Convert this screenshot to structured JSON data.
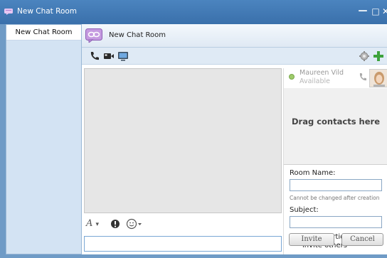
{
  "window": {
    "title": "New Chat Room",
    "minimize_glyph": "—",
    "maximize_glyph": "□",
    "close_glyph": "✕"
  },
  "tabs": [
    {
      "label": "New Chat Room",
      "selected": true
    }
  ],
  "room": {
    "title": "New Chat Room",
    "icon": "chat-room-icon"
  },
  "toolbar": {
    "icons": [
      "phone-icon",
      "video-camera-icon",
      "screen-share-icon",
      "gear-icon",
      "add-participant-icon"
    ]
  },
  "contacts": [
    {
      "name": "Maureen Vild",
      "status": "Available",
      "status_color": "#9ecb6a"
    }
  ],
  "dropzone": {
    "text": "Drag contacts here"
  },
  "form": {
    "room_name_label": "Room Name:",
    "room_name_value": "",
    "room_name_hint": "Cannot be changed after creation",
    "subject_label": "Subject:",
    "subject_value": "",
    "allow_invite_label": "Allow participants to invite others",
    "allow_invite_checked": true,
    "invite_label": "Invite",
    "cancel_label": "Cancel"
  },
  "format_bar": {
    "font_glyph": "A",
    "dropdown_glyph": "▾"
  },
  "message_input": {
    "value": ""
  },
  "colors": {
    "titlebar": "#3f78b4",
    "accent": "#7aa7d4",
    "available": "#9ecb6a",
    "add_green": "#3ca23c"
  }
}
